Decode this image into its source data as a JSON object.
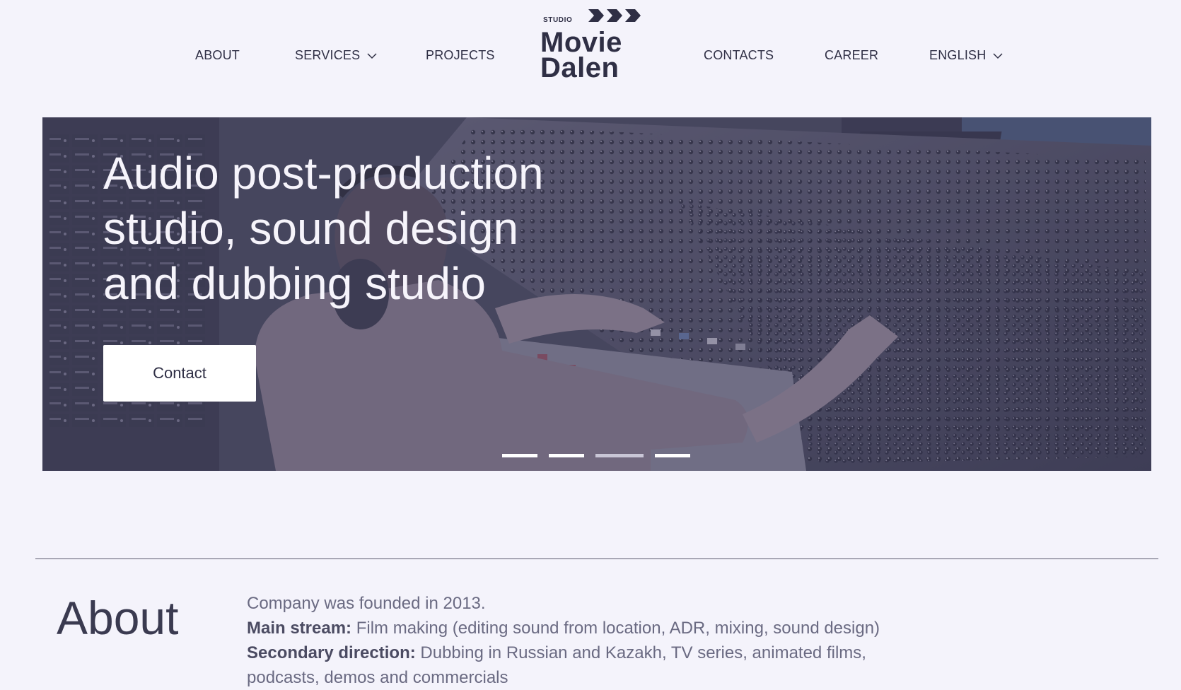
{
  "nav": {
    "about": "ABOUT",
    "services": "SERVICES",
    "projects": "PROJECTS",
    "contacts": "CONTACTS",
    "career": "CAREER",
    "language": "ENGLISH"
  },
  "logo": {
    "small": "STUDIO",
    "line1": "Movie",
    "line2": "Dalen"
  },
  "hero": {
    "title_lines": [
      "Audio post-production",
      "studio, sound design",
      "and dubbing studio"
    ],
    "cta": "Contact",
    "slides_total": 4,
    "active_slide": 3
  },
  "about": {
    "heading": "About",
    "founded": "Company was founded in 2013.",
    "main_label": "Main stream:",
    "main_text": " Film making (editing sound from location, ADR, mixing, sound design)",
    "secondary_label": "Secondary direction:",
    "secondary_text": " Dubbing in Russian and Kazakh, TV series, animated films,",
    "secondary_text_2": "podcasts, demos and commercials"
  },
  "colors": {
    "page_bg": "#f4f3fb",
    "text_dark": "#2f2f45",
    "text_muted": "#6a6a82",
    "hero_overlay": "#4a4a63"
  }
}
